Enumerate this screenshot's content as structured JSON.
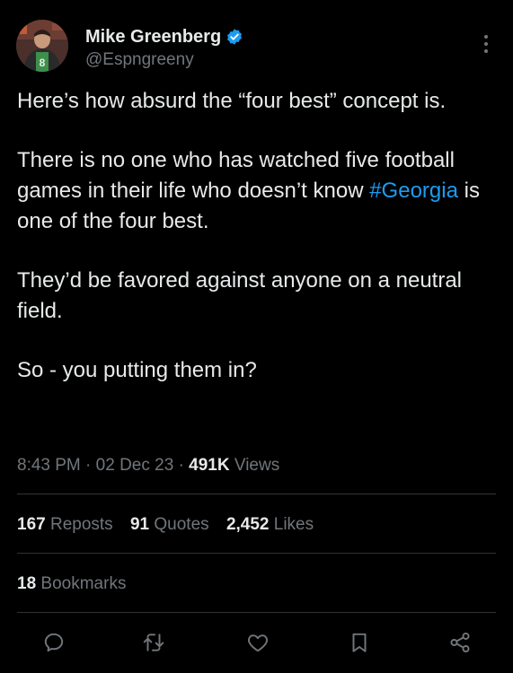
{
  "author": {
    "display_name": "Mike Greenberg",
    "handle": "@Espngreeny",
    "verified_icon": "verified-badge-icon",
    "verified_color": "#1d9bf0"
  },
  "tweet": {
    "paragraphs": [
      {
        "text": "Here’s how absurd the “four best” concept is."
      },
      {
        "before": "There is no one who has watched five football games in their life who doesn’t know ",
        "hashtag": "#Georgia",
        "after": " is one of the four best."
      },
      {
        "text": "They’d be favored against anyone on a neutral field."
      },
      {
        "text": "So - you putting them in?"
      }
    ],
    "link_color": "#1d9bf0"
  },
  "meta": {
    "time": "8:43 PM",
    "separator": "·",
    "date": "02 Dec 23",
    "views_count": "491K",
    "views_label": "Views"
  },
  "stats": {
    "reposts_count": "167",
    "reposts_label": "Reposts",
    "quotes_count": "91",
    "quotes_label": "Quotes",
    "likes_count": "2,452",
    "likes_label": "Likes",
    "bookmarks_count": "18",
    "bookmarks_label": "Bookmarks"
  },
  "actions": [
    {
      "name": "reply",
      "icon": "reply-icon"
    },
    {
      "name": "repost",
      "icon": "repost-icon"
    },
    {
      "name": "like",
      "icon": "heart-icon"
    },
    {
      "name": "bookmark",
      "icon": "bookmark-icon"
    },
    {
      "name": "share",
      "icon": "share-icon"
    }
  ],
  "colors": {
    "background": "#000000",
    "text": "#e7e9ea",
    "secondary": "#71767b",
    "divider": "#2f3336"
  }
}
